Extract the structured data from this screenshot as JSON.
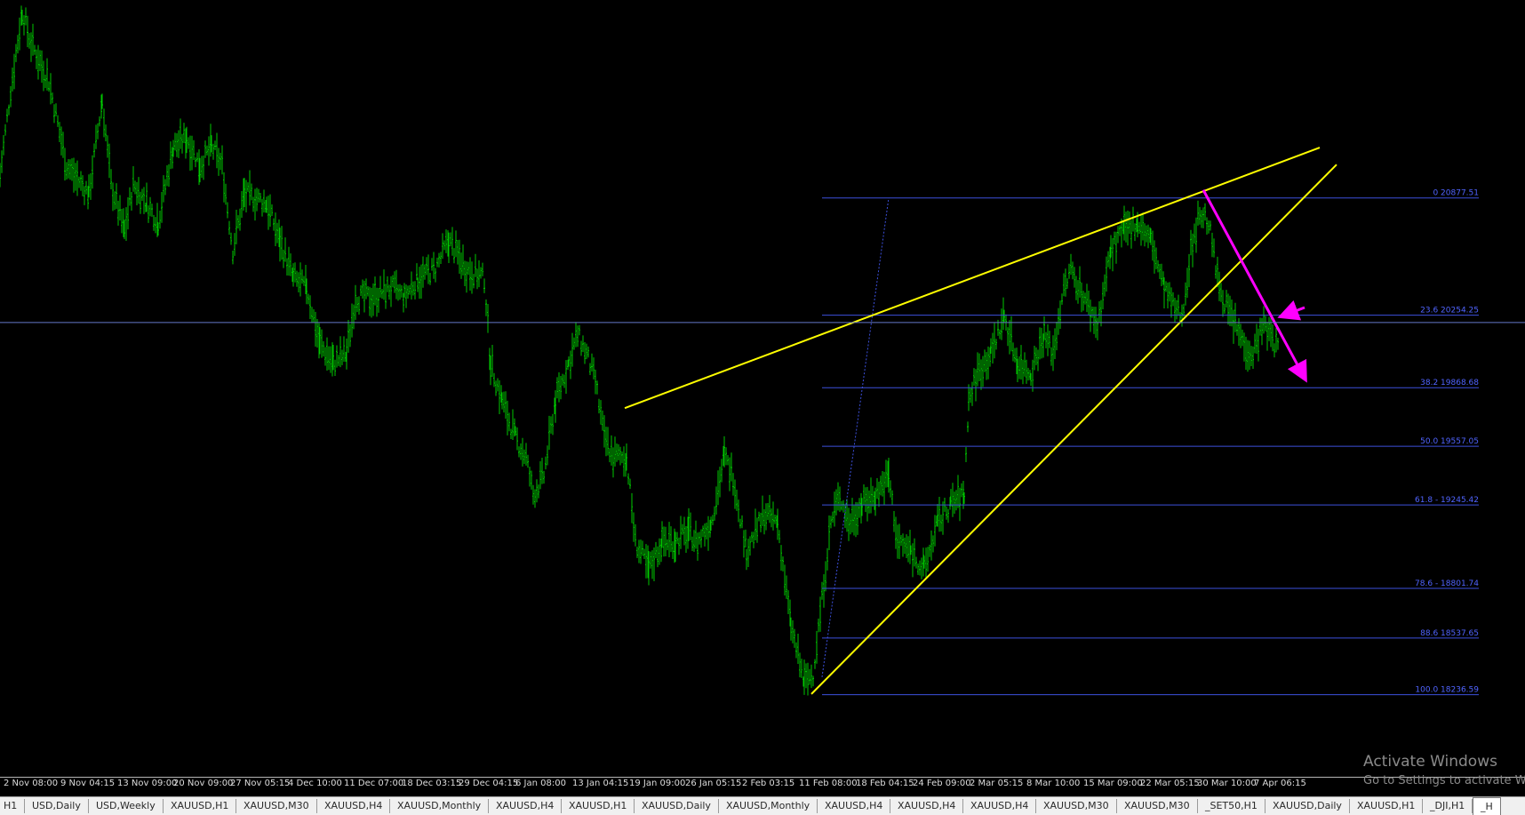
{
  "chart_data": {
    "type": "candlestick-bars",
    "symbol": "XAUUSD",
    "price_range": [
      17800,
      21930
    ],
    "current_price": 20215,
    "fibonacci": {
      "start_price": 18330,
      "end_price": 20877.51,
      "levels": [
        {
          "label": "0 20877.51",
          "price": 20877.51
        },
        {
          "label": "23.6 20254.25",
          "price": 20254.25
        },
        {
          "label": "38.2 19868.68",
          "price": 19868.68
        },
        {
          "label": "50.0 19557.05",
          "price": 19557.05
        },
        {
          "label": "61.8 - 19245.42",
          "price": 19245.42
        },
        {
          "label": "78.6 - 18801.74",
          "price": 18801.74
        },
        {
          "label": "88.6 18537.65",
          "price": 18537.65
        },
        {
          "label": "100.0 18236.59",
          "price": 18236.59
        }
      ]
    },
    "trendlines": [
      {
        "color": "#ffff00",
        "from": {
          "bar": 703,
          "price": 19760
        },
        "to": {
          "bar": 1485,
          "price": 21145
        }
      },
      {
        "color": "#ffff00",
        "from": {
          "bar": 913,
          "price": 18240
        },
        "to": {
          "bar": 1504,
          "price": 21055
        }
      },
      {
        "color": "#ff00ff",
        "arrow": true,
        "from": {
          "bar": 1354,
          "price": 20920
        },
        "to": {
          "bar": 1468,
          "price": 19920
        }
      },
      {
        "color": "#ff00ff",
        "arrow": true,
        "from": {
          "bar": 1468,
          "price": 20295
        },
        "to": {
          "bar": 1443,
          "price": 20250
        }
      }
    ],
    "bars_anchors": [
      [
        0,
        21000
      ],
      [
        12,
        21450
      ],
      [
        25,
        21870
      ],
      [
        35,
        21700
      ],
      [
        55,
        21500
      ],
      [
        75,
        21050
      ],
      [
        100,
        20900
      ],
      [
        115,
        21400
      ],
      [
        125,
        20950
      ],
      [
        140,
        20700
      ],
      [
        150,
        20950
      ],
      [
        165,
        20850
      ],
      [
        178,
        20750
      ],
      [
        195,
        21150
      ],
      [
        210,
        21200
      ],
      [
        225,
        21050
      ],
      [
        238,
        21150
      ],
      [
        250,
        21050
      ],
      [
        262,
        20600
      ],
      [
        275,
        20900
      ],
      [
        300,
        20850
      ],
      [
        315,
        20650
      ],
      [
        330,
        20450
      ],
      [
        345,
        20400
      ],
      [
        360,
        20100
      ],
      [
        375,
        20000
      ],
      [
        390,
        20050
      ],
      [
        400,
        20350
      ],
      [
        420,
        20350
      ],
      [
        440,
        20400
      ],
      [
        455,
        20350
      ],
      [
        470,
        20450
      ],
      [
        490,
        20500
      ],
      [
        505,
        20650
      ],
      [
        525,
        20500
      ],
      [
        545,
        20450
      ],
      [
        552,
        20000
      ],
      [
        565,
        19800
      ],
      [
        580,
        19600
      ],
      [
        592,
        19500
      ],
      [
        600,
        19300
      ],
      [
        612,
        19400
      ],
      [
        625,
        19800
      ],
      [
        640,
        20000
      ],
      [
        650,
        20150
      ],
      [
        660,
        20050
      ],
      [
        670,
        19900
      ],
      [
        680,
        19600
      ],
      [
        690,
        19500
      ],
      [
        705,
        19500
      ],
      [
        715,
        19050
      ],
      [
        730,
        18900
      ],
      [
        745,
        19050
      ],
      [
        760,
        19050
      ],
      [
        775,
        19100
      ],
      [
        785,
        19050
      ],
      [
        800,
        19150
      ],
      [
        815,
        19500
      ],
      [
        825,
        19400
      ],
      [
        840,
        19000
      ],
      [
        860,
        19200
      ],
      [
        875,
        19150
      ],
      [
        890,
        18600
      ],
      [
        905,
        18300
      ],
      [
        915,
        18350
      ],
      [
        925,
        18750
      ],
      [
        935,
        19150
      ],
      [
        945,
        19300
      ],
      [
        955,
        19150
      ],
      [
        970,
        19250
      ],
      [
        985,
        19300
      ],
      [
        1000,
        19400
      ],
      [
        1010,
        19050
      ],
      [
        1025,
        19000
      ],
      [
        1040,
        18900
      ],
      [
        1055,
        19150
      ],
      [
        1070,
        19250
      ],
      [
        1085,
        19300
      ],
      [
        1090,
        19800
      ],
      [
        1100,
        19950
      ],
      [
        1115,
        20050
      ],
      [
        1130,
        20250
      ],
      [
        1145,
        20000
      ],
      [
        1160,
        19950
      ],
      [
        1175,
        20150
      ],
      [
        1185,
        20050
      ],
      [
        1195,
        20350
      ],
      [
        1205,
        20500
      ],
      [
        1215,
        20400
      ],
      [
        1225,
        20300
      ],
      [
        1235,
        20200
      ],
      [
        1250,
        20600
      ],
      [
        1265,
        20700
      ],
      [
        1280,
        20750
      ],
      [
        1295,
        20650
      ],
      [
        1310,
        20400
      ],
      [
        1320,
        20300
      ],
      [
        1330,
        20250
      ],
      [
        1340,
        20600
      ],
      [
        1350,
        20800
      ],
      [
        1360,
        20750
      ],
      [
        1370,
        20450
      ],
      [
        1380,
        20300
      ],
      [
        1390,
        20200
      ],
      [
        1400,
        20100
      ],
      [
        1410,
        20050
      ],
      [
        1420,
        20200
      ],
      [
        1430,
        20150
      ],
      [
        1440,
        20050
      ]
    ]
  },
  "price_axis_color": "#b4b4b4",
  "time_axis": {
    "labels": [
      {
        "text": "2 Nov 08:00",
        "bar": 4
      },
      {
        "text": "9 Nov 04:15",
        "bar": 68
      },
      {
        "text": "13 Nov 09:00",
        "bar": 132
      },
      {
        "text": "20 Nov 09:00",
        "bar": 195
      },
      {
        "text": "27 Nov 05:15",
        "bar": 259
      },
      {
        "text": "4 Dec 10:00",
        "bar": 324
      },
      {
        "text": "11 Dec 07:00",
        "bar": 387
      },
      {
        "text": "18 Dec 03:15",
        "bar": 452
      },
      {
        "text": "29 Dec 04:15",
        "bar": 516
      },
      {
        "text": "6 Jan 08:00",
        "bar": 580
      },
      {
        "text": "13 Jan 04:15",
        "bar": 644
      },
      {
        "text": "19 Jan 09:00",
        "bar": 708
      },
      {
        "text": "26 Jan 05:15",
        "bar": 771
      },
      {
        "text": "2 Feb 03:15",
        "bar": 835
      },
      {
        "text": "11 Feb 08:00",
        "bar": 899
      },
      {
        "text": "18 Feb 04:15",
        "bar": 963
      },
      {
        "text": "24 Feb 09:00",
        "bar": 1027
      },
      {
        "text": "2 Mar 05:15",
        "bar": 1091
      },
      {
        "text": "8 Mar 10:00",
        "bar": 1155
      },
      {
        "text": "15 Mar 09:00",
        "bar": 1219
      },
      {
        "text": "22 Mar 05:15",
        "bar": 1283
      },
      {
        "text": "30 Mar 10:00",
        "bar": 1347
      },
      {
        "text": "7 Apr 06:15",
        "bar": 1411
      }
    ]
  },
  "tabs": [
    {
      "label": "H1",
      "active": false
    },
    {
      "label": "USD,Daily",
      "active": false
    },
    {
      "label": "USD,Weekly",
      "active": false
    },
    {
      "label": "XAUUSD,H1",
      "active": false
    },
    {
      "label": "XAUUSD,M30",
      "active": false
    },
    {
      "label": "XAUUSD,H4",
      "active": false
    },
    {
      "label": "XAUUSD,Monthly",
      "active": false
    },
    {
      "label": "XAUUSD,H4",
      "active": false
    },
    {
      "label": "XAUUSD,H1",
      "active": false
    },
    {
      "label": "XAUUSD,Daily",
      "active": false
    },
    {
      "label": "XAUUSD,Monthly",
      "active": false
    },
    {
      "label": "XAUUSD,H4",
      "active": false
    },
    {
      "label": "XAUUSD,H4",
      "active": false
    },
    {
      "label": "XAUUSD,H4",
      "active": false
    },
    {
      "label": "XAUUSD,M30",
      "active": false
    },
    {
      "label": "XAUUSD,M30",
      "active": false
    },
    {
      "label": "_SET50,H1",
      "active": false
    },
    {
      "label": "XAUUSD,Daily",
      "active": false
    },
    {
      "label": "XAUUSD,H1",
      "active": false
    },
    {
      "label": "_DJI,H1",
      "active": false
    },
    {
      "label": "_H",
      "active": true
    }
  ],
  "watermark": {
    "title": "Activate Windows",
    "subtitle": "Go to Settings to activate W"
  },
  "colors": {
    "bars": "#00c800",
    "fib_lines": "#3c50dc",
    "fib_text": "#5064ff",
    "trendline": "#ffff00",
    "arrow": "#ff00ff",
    "bid_line": "#6478c8"
  }
}
